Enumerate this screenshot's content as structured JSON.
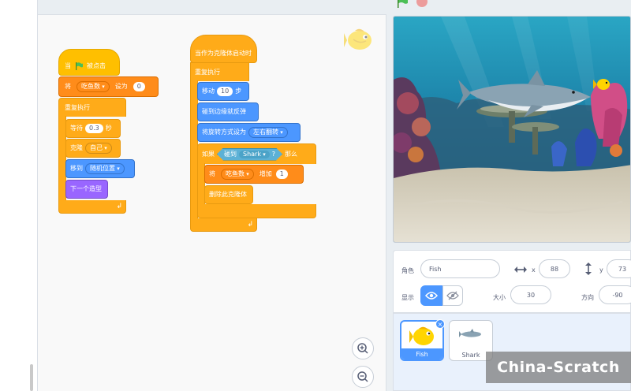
{
  "code": {
    "script1": {
      "hat_when": "当",
      "hat_clicked": "被点击",
      "set_label": "将",
      "set_var": "吃鱼数",
      "set_to": "设为",
      "set_value": "0",
      "forever": "重复执行",
      "wait": "等待",
      "wait_value": "0.3",
      "wait_unit": "秒",
      "clone": "克隆",
      "clone_target": "自己",
      "goto": "移到",
      "goto_target": "随机位置",
      "next_costume": "下一个造型"
    },
    "script2": {
      "hat": "当作为克隆体启动时",
      "forever": "重复执行",
      "move": "移动",
      "move_value": "10",
      "move_unit": "步",
      "bounce": "碰到边缘就反弹",
      "rotation_label": "将旋转方式设为",
      "rotation_value": "左右翻转",
      "if_label": "如果",
      "touching": "碰到",
      "touching_target": "Shark",
      "question": "?",
      "then": "那么",
      "change_label": "将",
      "change_var": "吃鱼数",
      "change_by": "增加",
      "change_value": "1",
      "delete_clone": "删除此克隆体"
    }
  },
  "sprite_info": {
    "sprite_label": "角色",
    "sprite_name": "Fish",
    "x_label": "x",
    "x_value": "88",
    "y_label": "y",
    "y_value": "73",
    "show_label": "显示",
    "size_label": "大小",
    "size_value": "30",
    "direction_label": "方向",
    "direction_value": "-90"
  },
  "sprites": [
    {
      "name": "Fish",
      "selected": true
    },
    {
      "name": "Shark",
      "selected": false
    }
  ],
  "watermark": "China-Scratch",
  "colors": {
    "events": "#ffbf00",
    "control": "#ffab19",
    "variables": "#ff8c1a",
    "motion": "#4c97ff",
    "looks": "#9966ff",
    "sensing": "#5cb1d6",
    "selected": "#4c97ff"
  }
}
